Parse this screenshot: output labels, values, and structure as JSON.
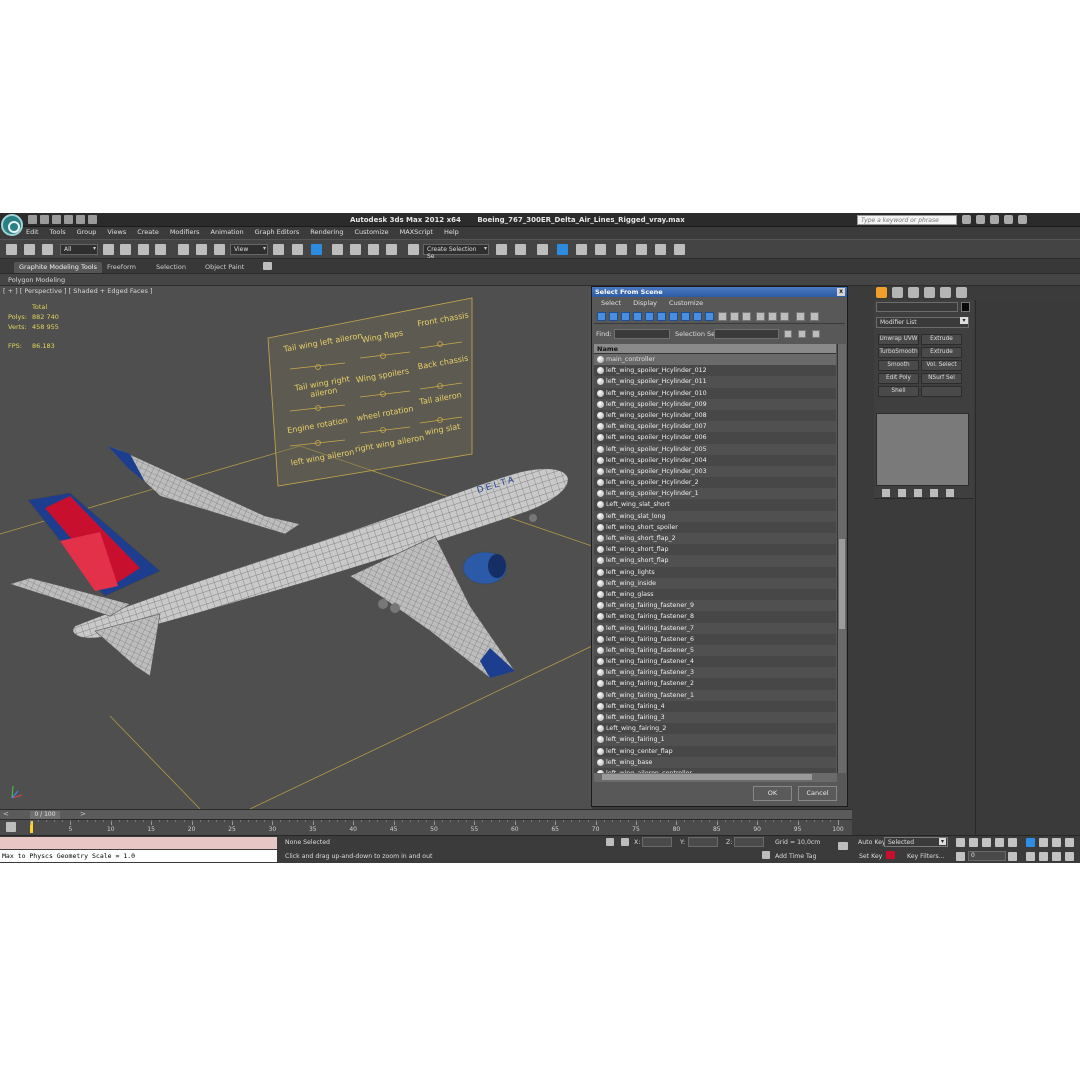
{
  "app": {
    "title": "Autodesk 3ds Max  2012 x64",
    "file": "Boeing_767_300ER_Delta_Air_Lines_Rigged_vray.max",
    "search_placeholder": "Type a keyword or phrase"
  },
  "menu": [
    "Edit",
    "Tools",
    "Group",
    "Views",
    "Create",
    "Modifiers",
    "Animation",
    "Graph Editors",
    "Rendering",
    "Customize",
    "MAXScript",
    "Help"
  ],
  "toolbar": {
    "filter_dropdown": "All",
    "refcoord_dropdown": "View",
    "selection_set_dropdown": "Create Selection Se"
  },
  "ribbon": {
    "tabs": [
      "Graphite Modeling Tools",
      "Freeform",
      "Selection",
      "Object Paint"
    ],
    "panel_label": "Polygon Modeling"
  },
  "viewport": {
    "label": "[ + ] [ Perspective ] [ Shaded + Edged Faces ]",
    "stats": {
      "header": "Total",
      "polys_label": "Polys:",
      "polys_value": "882 740",
      "verts_label": "Verts:",
      "verts_value": "458 955",
      "fps_label": "FPS:",
      "fps_value": "86.183"
    },
    "control_panel_labels": {
      "tail_wing_left_aileron": "Tail wing left aileron",
      "wing_flaps": "Wing flaps",
      "front_chassis": "Front chassis",
      "tail_wing_right_aileron": "Tail wing right aileron",
      "wing_spoilers": "Wing spoilers",
      "back_chassis": "Back chassis",
      "engine_rotation": "Engine rotation",
      "wheel_rotation": "wheel rotation",
      "tail_aileron": "Tail aileron",
      "left_wing_aileron": "left wing aileron",
      "right_wing_aileron": "right wing aileron",
      "wing_slat": "wing slat"
    }
  },
  "dialog": {
    "title": "Select From Scene",
    "close": "x",
    "menu": [
      "Select",
      "Display",
      "Customize"
    ],
    "find_label": "Find:",
    "selection_set_label": "Selection Set:",
    "column_header": "Name",
    "items": [
      "main_controller",
      "left_wing_spoiler_Hcylinder_012",
      "left_wing_spoiler_Hcylinder_011",
      "left_wing_spoiler_Hcylinder_010",
      "left_wing_spoiler_Hcylinder_009",
      "left_wing_spoiler_Hcylinder_008",
      "left_wing_spoiler_Hcylinder_007",
      "left_wing_spoiler_Hcylinder_006",
      "left_wing_spoiler_Hcylinder_005",
      "left_wing_spoiler_Hcylinder_004",
      "left_wing_spoiler_Hcylinder_003",
      "left_wing_spoiler_Hcylinder_2",
      "left_wing_spoiler_Hcylinder_1",
      "Left_wing_slat_short",
      "left_wing_slat_long",
      "left_wing_short_spoiler",
      "left_wing_short_flap_2",
      "left_wing_short_flap",
      "left_wing_short_flap",
      "left_wing_lights",
      "left_wing_inside",
      "left_wing_glass",
      "left_wing_fairing_fastener_9",
      "left_wing_fairing_fastener_8",
      "left_wing_fairing_fastener_7",
      "left_wing_fairing_fastener_6",
      "left_wing_fairing_fastener_5",
      "left_wing_fairing_fastener_4",
      "left_wing_fairing_fastener_3",
      "left_wing_fairing_fastener_2",
      "left_wing_fairing_fastener_1",
      "left_wing_fairing_4",
      "left_wing_fairing_3",
      "Left_wing_fairing_2",
      "left_wing_fairing_1",
      "left_wing_center_flap",
      "left_wing_base",
      "left_wing_aileron_controller"
    ],
    "ok_label": "OK",
    "cancel_label": "Cancel"
  },
  "command_panel": {
    "modifier_list": "Modifier List",
    "buttons": [
      "Unwrap UVW",
      "Extrude",
      "TurboSmooth",
      "Extrude",
      "Smooth",
      "Vol. Select",
      "Edit Poly",
      "NSurf Sel",
      "Shell"
    ]
  },
  "timeline": {
    "frame_counter": "0 / 100",
    "ticks": [
      "0",
      "5",
      "10",
      "15",
      "20",
      "25",
      "30",
      "35",
      "40",
      "45",
      "50",
      "55",
      "60",
      "65",
      "70",
      "75",
      "80",
      "85",
      "90",
      "95",
      "100"
    ]
  },
  "status": {
    "maxscript_output": "Max to Physcs Geometry Scale = 1.0",
    "selection_status": "None Selected",
    "prompt": "Click and drag up-and-down to zoom in and out",
    "x_label": "X:",
    "y_label": "Y:",
    "z_label": "Z:",
    "grid": "Grid = 10,0cm",
    "add_time_tag": "Add Time Tag",
    "auto_key": "Auto Key",
    "set_key": "Set Key",
    "selected_dropdown": "Selected",
    "key_filters": "Key Filters...",
    "current_frame": "0"
  },
  "colors": {
    "delta_red": "#c8102e",
    "delta_blue": "#1d3e8f",
    "viewport_bg": "#4f4f4f",
    "label_yellow": "#e9cf69",
    "dialog_title_blue": "#3a68b4"
  }
}
